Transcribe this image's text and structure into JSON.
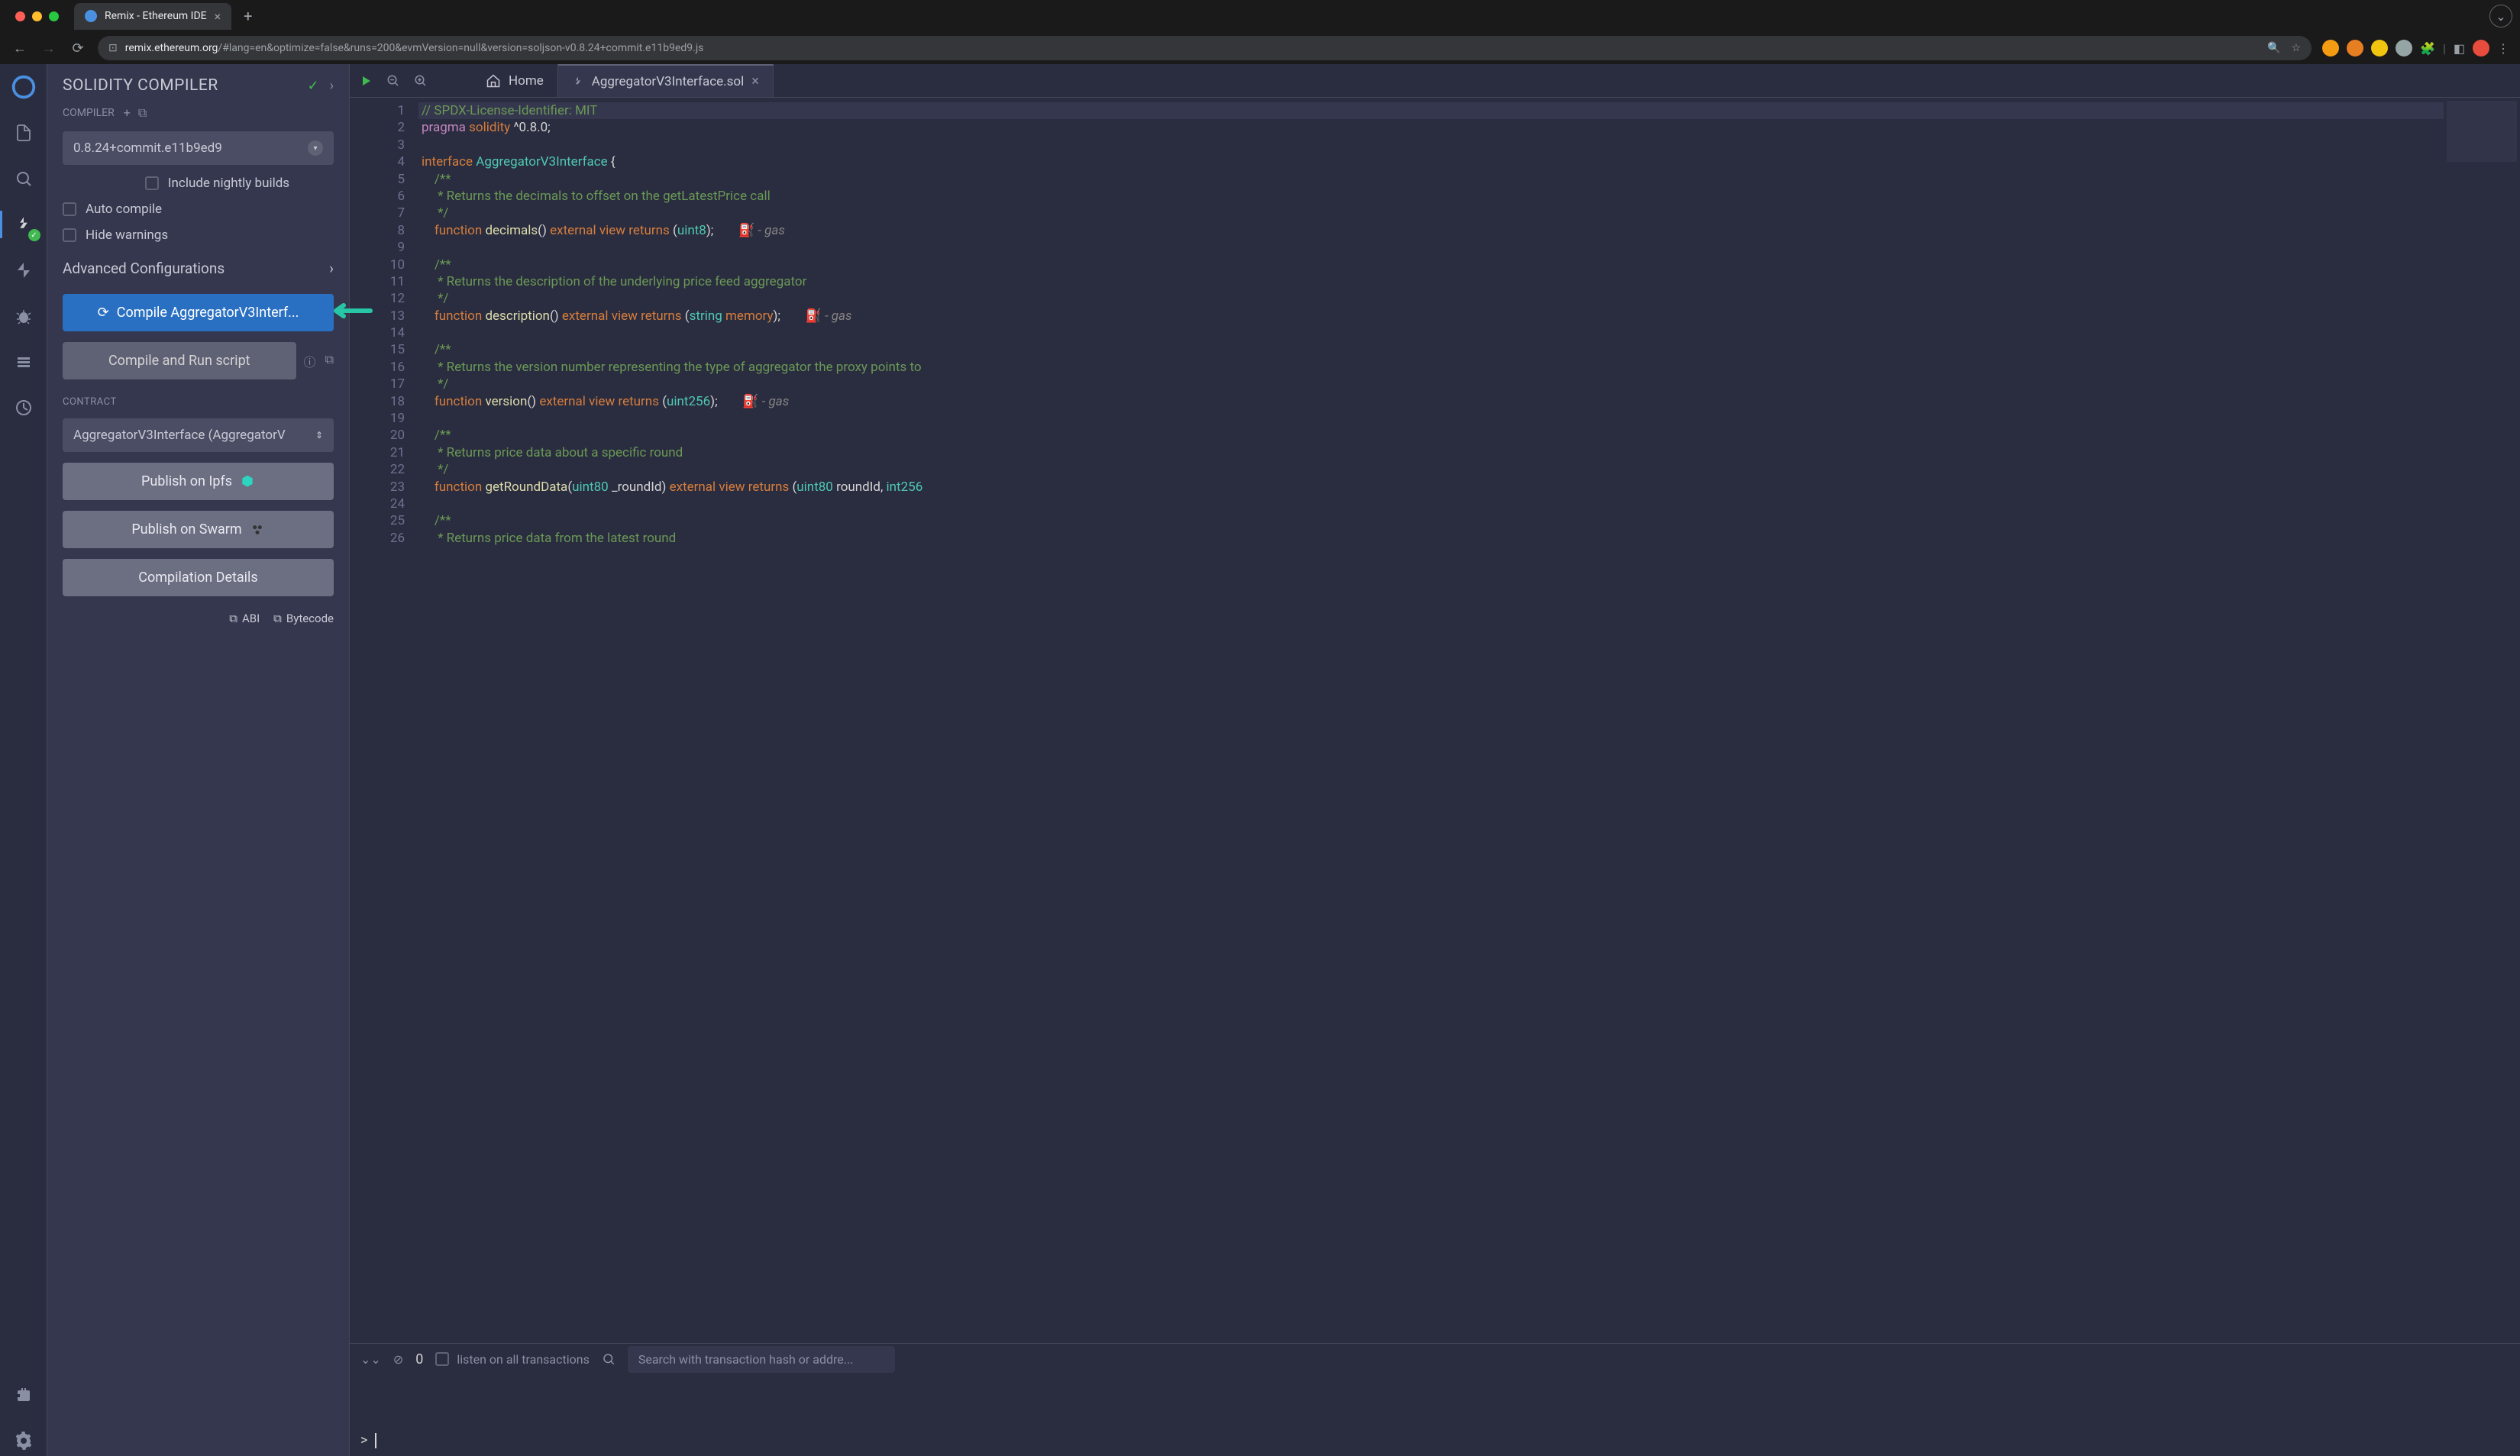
{
  "browser": {
    "tab_title": "Remix - Ethereum IDE",
    "url_host": "remix.ethereum.org",
    "url_path": "/#lang=en&optimize=false&runs=200&evmVersion=null&version=soljson-v0.8.24+commit.e11b9ed9.js"
  },
  "panel": {
    "title": "SOLIDITY COMPILER",
    "compiler_label": "COMPILER",
    "compiler_version": "0.8.24+commit.e11b9ed9",
    "nightly": "Include nightly builds",
    "auto_compile": "Auto compile",
    "hide_warnings": "Hide warnings",
    "advanced": "Advanced Configurations",
    "compile_btn": "Compile AggregatorV3Interf...",
    "compile_run": "Compile and Run script",
    "contract_label": "CONTRACT",
    "contract_select": "AggregatorV3Interface (AggregatorV",
    "publish_ipfs": "Publish on Ipfs",
    "publish_swarm": "Publish on Swarm",
    "compilation_details": "Compilation Details",
    "abi": "ABI",
    "bytecode": "Bytecode"
  },
  "tabs": {
    "home": "Home",
    "file": "AggregatorV3Interface.sol"
  },
  "code": {
    "lines": [
      {
        "n": 1,
        "html": "<span class='c-comment'>// SPDX-License-Identifier: MIT</span>",
        "hl": true
      },
      {
        "n": 2,
        "html": "<span class='c-pragma'>pragma</span> <span class='c-keyword'>solidity</span> <span class='c-punct'>^0.8.0;</span>"
      },
      {
        "n": 3,
        "html": ""
      },
      {
        "n": 4,
        "html": "<span class='c-keyword'>interface</span> <span class='c-type'>AggregatorV3Interface</span> <span class='c-punct'>{</span>"
      },
      {
        "n": 5,
        "html": "    <span class='c-comment'>/**</span>"
      },
      {
        "n": 6,
        "html": "    <span class='c-comment'> * Returns the decimals to offset on the getLatestPrice call</span>"
      },
      {
        "n": 7,
        "html": "    <span class='c-comment'> */</span>"
      },
      {
        "n": 8,
        "html": "    <span class='c-keyword'>function</span> <span class='c-ident'>decimals</span><span class='c-punct'>()</span> <span class='c-keyword'>external</span> <span class='c-keyword'>view</span> <span class='c-keyword'>returns</span> <span class='c-punct'>(</span><span class='c-type'>uint8</span><span class='c-punct'>);</span><span class='gas-icon'>   ⛽ <span class='c-gas'>- gas</span></span>"
      },
      {
        "n": 9,
        "html": ""
      },
      {
        "n": 10,
        "html": "    <span class='c-comment'>/**</span>"
      },
      {
        "n": 11,
        "html": "    <span class='c-comment'> * Returns the description of the underlying price feed aggregator</span>"
      },
      {
        "n": 12,
        "html": "    <span class='c-comment'> */</span>"
      },
      {
        "n": 13,
        "html": "    <span class='c-keyword'>function</span> <span class='c-ident'>description</span><span class='c-punct'>()</span> <span class='c-keyword'>external</span> <span class='c-keyword'>view</span> <span class='c-keyword'>returns</span> <span class='c-punct'>(</span><span class='c-type'>string</span> <span class='c-keyword'>memory</span><span class='c-punct'>);</span><span class='gas-icon'>   ⛽ <span class='c-gas'>- gas</span></span>"
      },
      {
        "n": 14,
        "html": ""
      },
      {
        "n": 15,
        "html": "    <span class='c-comment'>/**</span>"
      },
      {
        "n": 16,
        "html": "    <span class='c-comment'> * Returns the version number representing the type of aggregator the proxy points to</span>"
      },
      {
        "n": 17,
        "html": "    <span class='c-comment'> */</span>"
      },
      {
        "n": 18,
        "html": "    <span class='c-keyword'>function</span> <span class='c-ident'>version</span><span class='c-punct'>()</span> <span class='c-keyword'>external</span> <span class='c-keyword'>view</span> <span class='c-keyword'>returns</span> <span class='c-punct'>(</span><span class='c-type'>uint256</span><span class='c-punct'>);</span><span class='gas-icon'>   ⛽ <span class='c-gas'>- gas</span></span>"
      },
      {
        "n": 19,
        "html": ""
      },
      {
        "n": 20,
        "html": "    <span class='c-comment'>/**</span>"
      },
      {
        "n": 21,
        "html": "    <span class='c-comment'> * Returns price data about a specific round</span>"
      },
      {
        "n": 22,
        "html": "    <span class='c-comment'> */</span>"
      },
      {
        "n": 23,
        "html": "    <span class='c-keyword'>function</span> <span class='c-ident'>getRoundData</span><span class='c-punct'>(</span><span class='c-type'>uint80</span> <span class='c-punct'>_roundId)</span> <span class='c-keyword'>external</span> <span class='c-keyword'>view</span> <span class='c-keyword'>returns</span> <span class='c-punct'>(</span><span class='c-type'>uint80</span> <span class='c-punct'>roundId,</span> <span class='c-type'>int256</span>"
      },
      {
        "n": 24,
        "html": ""
      },
      {
        "n": 25,
        "html": "    <span class='c-comment'>/**</span>"
      },
      {
        "n": 26,
        "html": "    <span class='c-comment'> * Returns price data from the latest round</span>"
      }
    ]
  },
  "terminal": {
    "count": "0",
    "listen": "listen on all transactions",
    "search_placeholder": "Search with transaction hash or addre...",
    "prompt": ">"
  }
}
